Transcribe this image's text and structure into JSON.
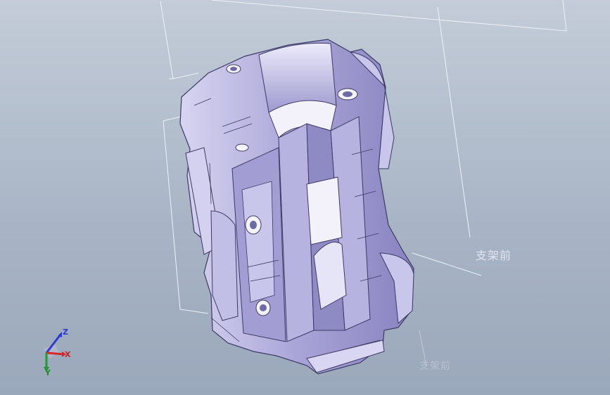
{
  "viewport": {
    "background_top": "#c3ccd8",
    "background_bottom": "#9aa8bb",
    "part_color": "#a8a4d6",
    "part_shadow": "#6e6aa6",
    "plane_line_color": "#eef2f7"
  },
  "planes": {
    "front_label": "支架前",
    "faded_label": "支架前"
  },
  "triad": {
    "x_label": "X",
    "y_label": "Y",
    "z_label": "Z",
    "x_color": "#d22a2a",
    "y_color": "#1f9a2e",
    "z_color": "#2f3bd6"
  }
}
